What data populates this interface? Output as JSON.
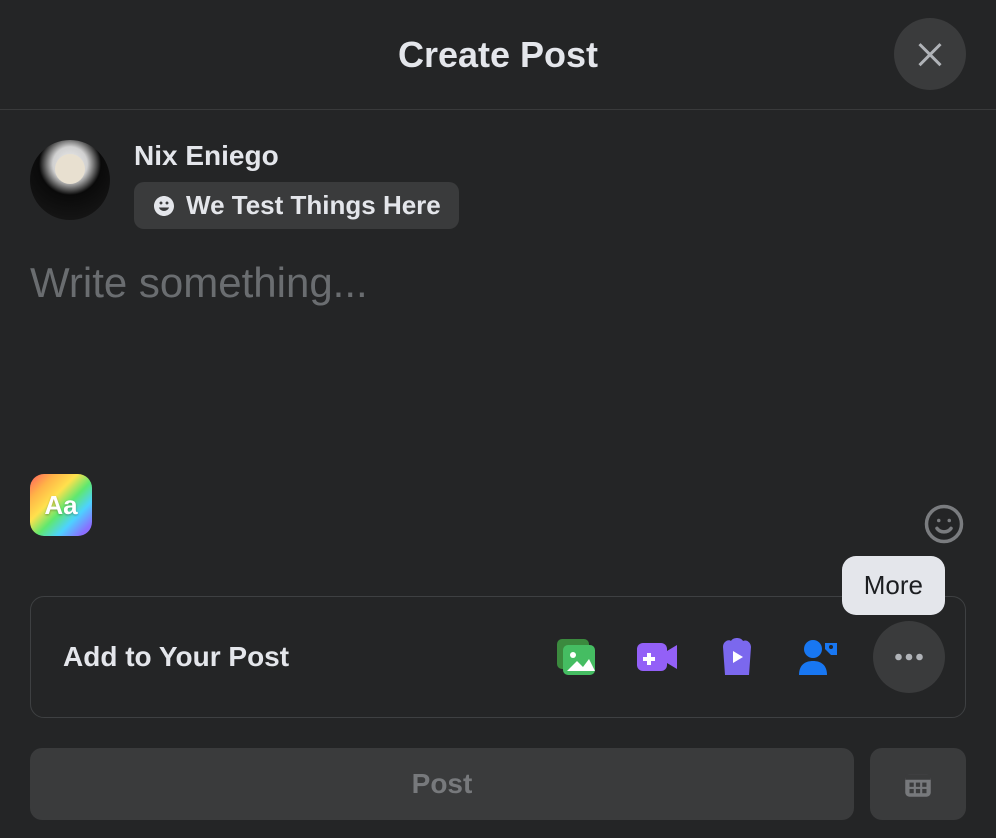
{
  "header": {
    "title": "Create Post"
  },
  "user": {
    "name": "Nix Eniego",
    "audience_label": "We Test Things Here"
  },
  "compose": {
    "placeholder": "Write something...",
    "value": "",
    "bg_picker_label": "Aa"
  },
  "addons": {
    "label": "Add to Your Post",
    "tooltip_more": "More"
  },
  "footer": {
    "post_label": "Post"
  }
}
